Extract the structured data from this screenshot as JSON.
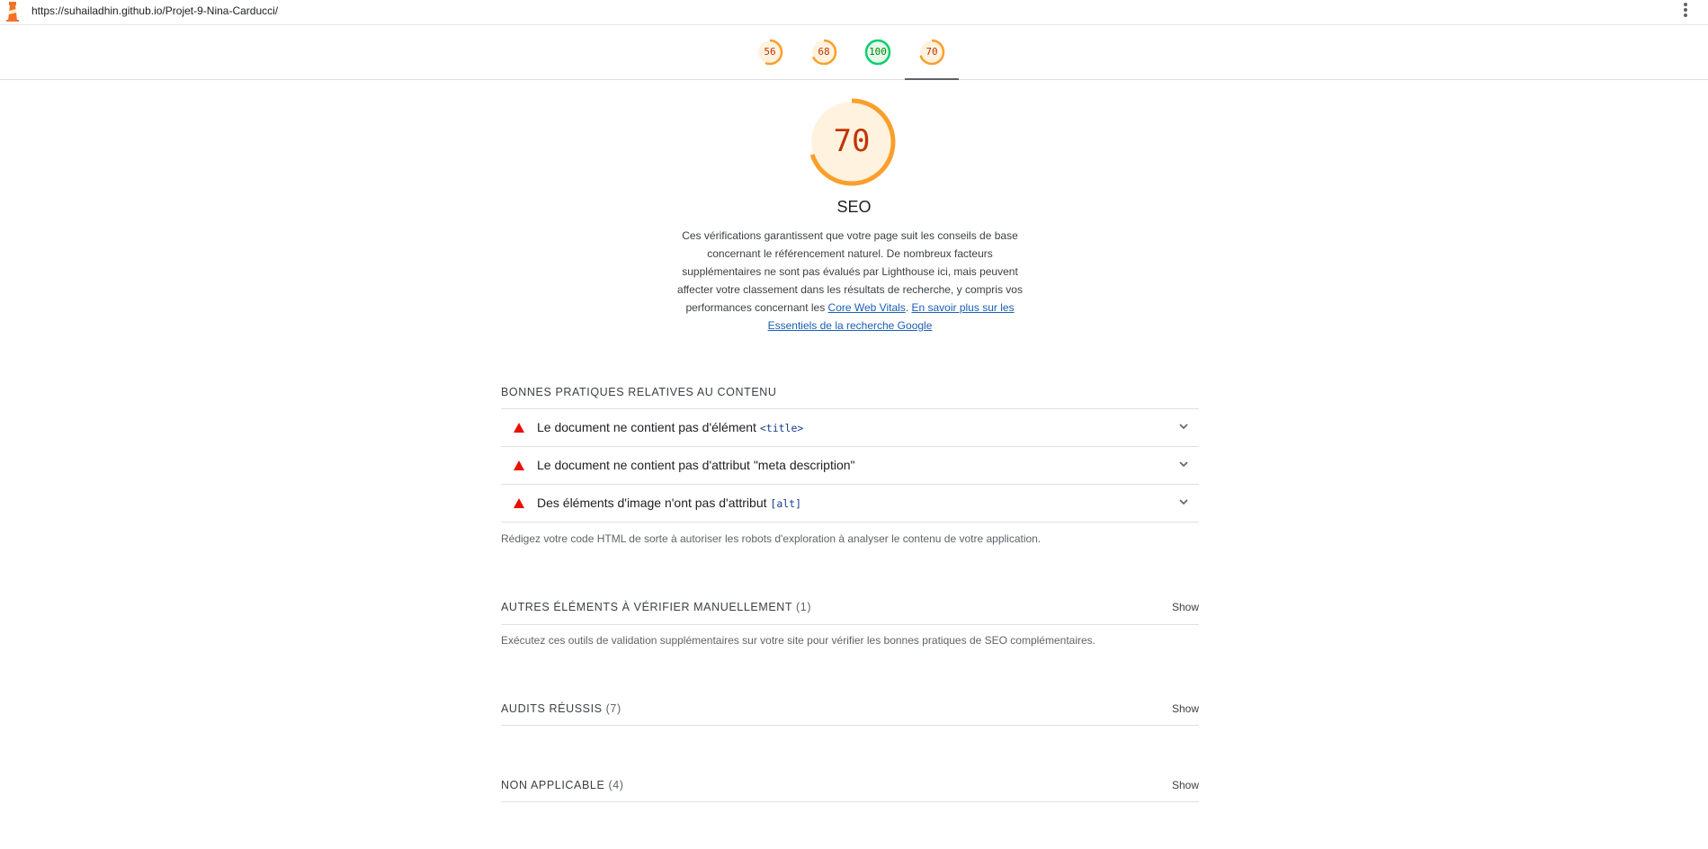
{
  "browser": {
    "url": "https://suhailadhin.github.io/Projet-9-Nina-Carducci/"
  },
  "score_tabs": [
    {
      "label": "56",
      "value": 56,
      "color": "#fa9f2b",
      "text_color": "#c33300"
    },
    {
      "label": "68",
      "value": 68,
      "color": "#fa9f2b",
      "text_color": "#c33300"
    },
    {
      "label": "100",
      "value": 100,
      "color": "#0cce6b",
      "text_color": "#008800"
    },
    {
      "label": "70",
      "value": 70,
      "color": "#fa9f2b",
      "text_color": "#c33300"
    }
  ],
  "category": {
    "score_label": "70",
    "score": 70,
    "gauge_color": "#fa9f2b",
    "title": "SEO",
    "desc_part1": "Ces vérifications garantissent que votre page suit les conseils de base concernant le référencement naturel. De nombreux facteurs supplémentaires ne sont pas évalués par Lighthouse ici, mais peuvent affecter votre classement dans les résultats de recherche, y compris vos performances concernant les ",
    "desc_link1": "Core Web Vitals",
    "desc_sep": ". ",
    "desc_link2": "En savoir plus sur les Essentiels de la recherche Google"
  },
  "content_section": {
    "title": "Bonnes pratiques relatives au contenu",
    "audits": [
      {
        "text": "Le document ne contient pas d'élément ",
        "code": "<title>"
      },
      {
        "text": "Le document ne contient pas d'attribut \"meta description\"",
        "code": ""
      },
      {
        "text": "Des éléments d'image n'ont pas d'attribut ",
        "code": "[alt]"
      }
    ],
    "note": "Rédigez votre code HTML de sorte à autoriser les robots d'exploration à analyser le contenu de votre application."
  },
  "manual_section": {
    "title": "Autres éléments à vérifier manuellement",
    "count": "(1)",
    "show": "Show",
    "note": "Exécutez ces outils de validation supplémentaires sur votre site pour vérifier les bonnes pratiques de SEO complémentaires."
  },
  "passed_section": {
    "title": "Audits réussis",
    "count": "(7)",
    "show": "Show"
  },
  "na_section": {
    "title": "Non applicable",
    "count": "(4)",
    "show": "Show"
  }
}
